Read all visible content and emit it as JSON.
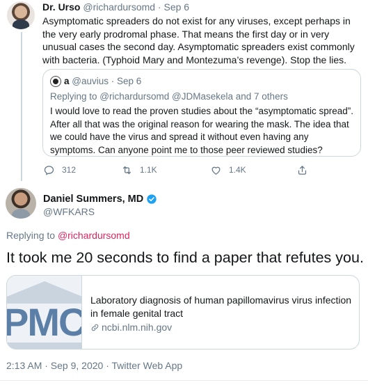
{
  "colors": {
    "link_pink": "#e0245e",
    "meta_gray": "#657786",
    "border": "#ccd6dd",
    "verified_blue": "#1da1f2",
    "pmc_blue": "#5b7fa6"
  },
  "tweet1": {
    "name": "Dr. Urso",
    "handle": "@richardursomd",
    "sep": " · ",
    "date": "Sep 6",
    "text": "Asymptomatic spreaders do not exist for any viruses, except perhaps in the very early prodromal phase. That means the first day or in very unusual cases the second day. Asymptomatic spreaders exist commonly with bacteria. (Typhoid Mary and Montezuma’s revenge). Stop the lies.",
    "quote": {
      "name": "a",
      "handle": "@auvius",
      "sep": " · ",
      "date": "Sep 6",
      "replying_prefix": "Replying to ",
      "replying_to": "@richardursomd @JDMasekela and 7 others",
      "text": "I would love to read the proven studies about the “asymptomatic spread”. After all that was the original reason for wearing the mask. The idea that we could have the virus and spread it without even having any symptoms. Can anyone point me to those peer reviewed studies?"
    },
    "actions": {
      "reply_count": "312",
      "retweet_count": "1.1K",
      "like_count": "1.4K",
      "icons": [
        "reply-icon",
        "retweet-icon",
        "like-icon",
        "share-icon"
      ]
    }
  },
  "tweet2": {
    "name": "Daniel Summers, MD",
    "handle": "@WFKARS",
    "verified_icon": "verified-badge-icon",
    "replying_prefix": "Replying to ",
    "replying_to": "@richardursomd",
    "text": "It took me 20 seconds to find a paper that refutes you.",
    "card": {
      "thumb_text": "PMC",
      "title": "Laboratory diagnosis of human papillomavirus virus infection in female genital tract",
      "domain": "ncbi.nlm.nih.gov",
      "domain_icon": "link-icon"
    },
    "timestamp": "2:13 AM · Sep 9, 2020 · ",
    "app": "Twitter Web App"
  }
}
